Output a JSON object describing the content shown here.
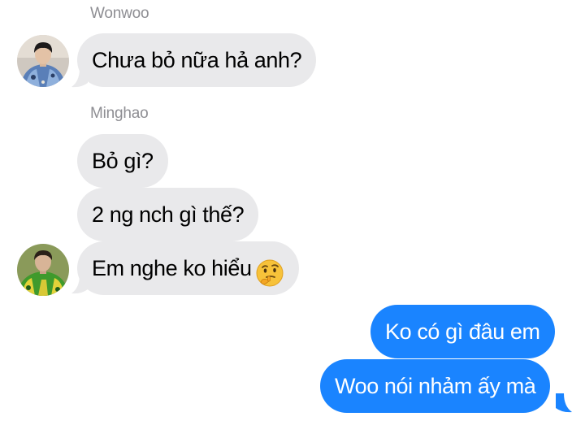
{
  "conversation": {
    "group1": {
      "sender": "Wonwoo",
      "messages": [
        {
          "text": "Chưa bỏ nữa hả anh?"
        }
      ]
    },
    "group2": {
      "sender": "Minghao",
      "messages": [
        {
          "text": "Bỏ gì?"
        },
        {
          "text": "2 ng nch gì thế?"
        },
        {
          "text": "Em nghe ko hiểu",
          "emoji": "thinking-face-emoji"
        }
      ]
    },
    "outgoing": {
      "messages": [
        {
          "text": "Ko có gì đâu em"
        },
        {
          "text": "Woo nói nhảm ấy mà"
        }
      ]
    }
  },
  "colors": {
    "incoming_bubble": "#e9e9eb",
    "outgoing_bubble": "#1a84ff",
    "sender_name": "#8e8e93"
  }
}
